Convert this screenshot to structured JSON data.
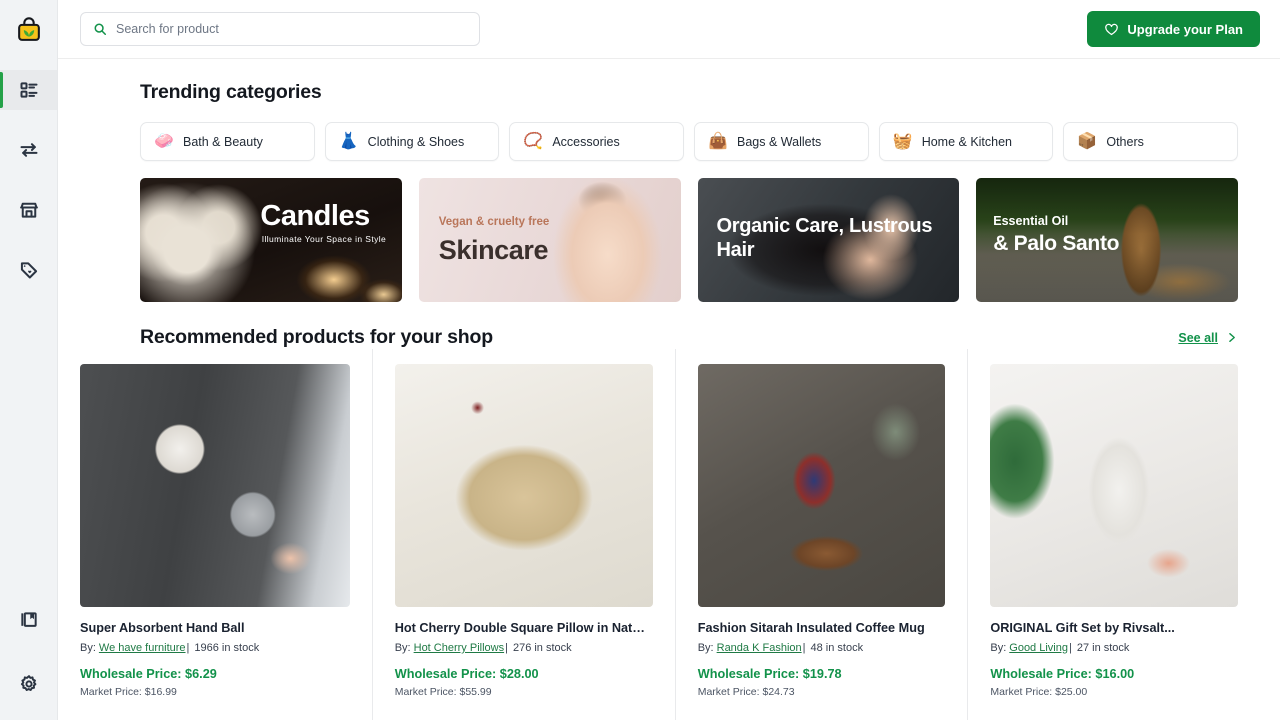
{
  "brand": {
    "logo_icon": "shopping-bag-leaf-logo",
    "accent_green": "#0f8a3d",
    "link_green": "#12924a"
  },
  "sidebar": {
    "top_items": [
      {
        "icon": "dashboard-list-icon",
        "name": "dashboard",
        "active": true
      },
      {
        "icon": "transfer-arrows-icon",
        "name": "transfers",
        "active": false
      },
      {
        "icon": "storefront-icon",
        "name": "store",
        "active": false
      },
      {
        "icon": "tag-heart-icon",
        "name": "favorites",
        "active": false
      }
    ],
    "bottom_items": [
      {
        "icon": "bookmark-library-icon",
        "name": "library",
        "active": false
      },
      {
        "icon": "gear-icon",
        "name": "settings",
        "active": false
      }
    ]
  },
  "topbar": {
    "search": {
      "placeholder": "Search for product",
      "value": "",
      "icon": "search-icon"
    },
    "upgrade": {
      "label": "Upgrade your Plan",
      "icon": "heart-icon"
    }
  },
  "trending": {
    "title": "Trending categories",
    "categories": [
      {
        "label": "Bath & Beauty",
        "emoji": "🧼"
      },
      {
        "label": "Clothing & Shoes",
        "emoji": "👗"
      },
      {
        "label": "Accessories",
        "emoji": "📿"
      },
      {
        "label": "Bags & Wallets",
        "emoji": "👜"
      },
      {
        "label": "Home & Kitchen",
        "emoji": "🧺"
      },
      {
        "label": "Others",
        "emoji": "📦"
      }
    ]
  },
  "banners": [
    {
      "id": "candles",
      "title": "Candles",
      "subtitle": "Illuminate Your Space in Style"
    },
    {
      "id": "skincare",
      "title": "Skincare",
      "subtitle": "Vegan & cruelty free"
    },
    {
      "id": "hair",
      "title": "Organic Care, Lustrous Hair",
      "subtitle": ""
    },
    {
      "id": "palosanto",
      "title": "& Palo Santo",
      "subtitle": "Essential Oil"
    }
  ],
  "recommended": {
    "title": "Recommended products for your shop",
    "see_all": {
      "label": "See all",
      "icon": "chevron-right-icon"
    },
    "by_label": "By:",
    "separator": "|",
    "products": [
      {
        "title": "Super Absorbent Hand Ball",
        "vendor": "We have furniture",
        "stock": "1966 in stock",
        "wholesale": "Wholesale Price: $6.29",
        "market": "Market Price: $16.99",
        "image_alt": "hand-ball-towel-in-bathroom"
      },
      {
        "title": "Hot Cherry Double Square Pillow in Natura...",
        "vendor": "Hot Cherry Pillows",
        "stock": "276 in stock",
        "wholesale": "Wholesale Price: $28.00",
        "market": "Market Price:  $55.99",
        "image_alt": "beige-square-pillow-with-tag"
      },
      {
        "title": "Fashion Sitarah Insulated Coffee Mug",
        "vendor": "Randa K Fashion",
        "stock": "48 in stock",
        "wholesale": "Wholesale Price: $19.78",
        "market": "Market Price:  $24.73",
        "image_alt": "patterned-insulated-coffee-mug-on-board"
      },
      {
        "title": "ORIGINAL Gift Set by Rivsalt...",
        "vendor": "Good Living",
        "stock": "27 in stock",
        "wholesale": "Wholesale Price: $16.00",
        "market": "Market Price: $25.00",
        "image_alt": "rivsalt-gift-set-with-pink-salt"
      }
    ]
  }
}
